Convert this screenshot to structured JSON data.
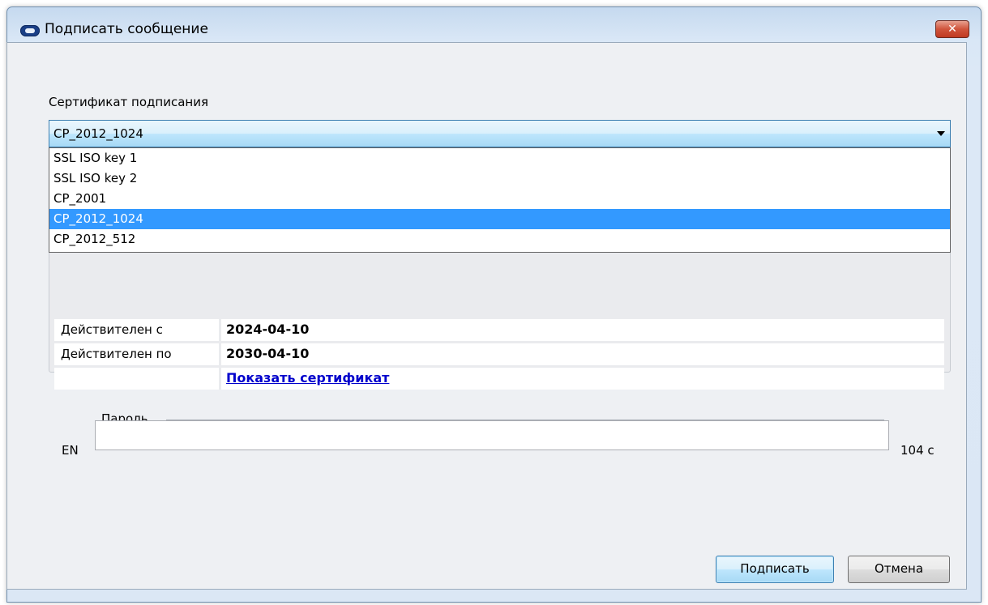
{
  "window": {
    "title": "Подписать сообщение",
    "close_label": "✕"
  },
  "certificate": {
    "label": "Сертификат подписания",
    "selected": "CP_2012_1024",
    "options": [
      {
        "label": "SSL ISO key 1"
      },
      {
        "label": "SSL ISO key 2"
      },
      {
        "label": "CP_2001"
      },
      {
        "label": "CP_2012_1024"
      },
      {
        "label": "CP_2012_512"
      }
    ]
  },
  "details": {
    "valid_from_label": "Действителен с",
    "valid_from": "2024-04-10",
    "valid_to_label": "Действителен по",
    "valid_to": "2030-04-10",
    "show_cert_link": "Показать сертификат"
  },
  "password": {
    "label": "Пароль",
    "value": "",
    "language": "EN",
    "timer": "104 с"
  },
  "buttons": {
    "sign": "Подписать",
    "cancel": "Отмена"
  },
  "colors": {
    "selection": "#3399ff",
    "link": "#0000cc"
  }
}
